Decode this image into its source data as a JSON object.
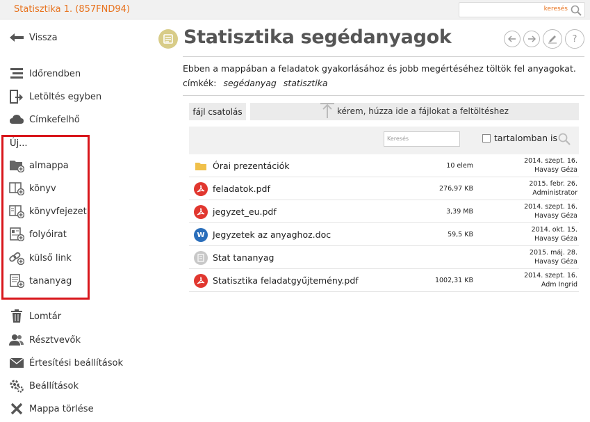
{
  "topbar": {
    "course_title": "Statisztika 1. (857FND94)",
    "search_placeholder": "keresés"
  },
  "sidebar": {
    "back": "Vissza",
    "items_top": [
      {
        "label": "Időrendben",
        "icon": "timeline-icon"
      },
      {
        "label": "Letöltés egyben",
        "icon": "download-icon"
      },
      {
        "label": "Címkefelhő",
        "icon": "tag-cloud-icon"
      }
    ],
    "new_label": "Új...",
    "new_items": [
      {
        "label": "almappa",
        "icon": "new-folder-icon"
      },
      {
        "label": "könyv",
        "icon": "new-book-icon"
      },
      {
        "label": "könyvfejezet",
        "icon": "new-chapter-icon"
      },
      {
        "label": "folyóirat",
        "icon": "new-journal-icon"
      },
      {
        "label": "külső link",
        "icon": "new-link-icon"
      },
      {
        "label": "tananyag",
        "icon": "new-material-icon"
      }
    ],
    "items_bottom": [
      {
        "label": "Lomtár",
        "icon": "trash-icon"
      },
      {
        "label": "Résztvevők",
        "icon": "participants-icon"
      },
      {
        "label": "Értesítési beállítások",
        "icon": "envelope-icon"
      },
      {
        "label": "Beállítások",
        "icon": "gear-icon"
      },
      {
        "label": "Mappa törlése",
        "icon": "delete-x-icon"
      }
    ]
  },
  "main": {
    "title": "Statisztika segédanyagok",
    "description": "Ebben a mappában a feladatok gyakorlásához és jobb megértéséhez töltök fel anyagokat.",
    "tags_label": "címkék:",
    "tags": [
      "segédanyag",
      "statisztika"
    ],
    "attach_label": "fájl csatolás",
    "dropzone_text": "kérem, húzza ide a fájlokat a feltöltéshez",
    "files_search_placeholder": "Keresés",
    "content_search_label": "tartalomban is",
    "files": [
      {
        "name": "Órai prezentációk",
        "type": "folder",
        "size": "10 elem",
        "date": "2014. szept. 16.",
        "user": "Havasy Géza"
      },
      {
        "name": "feladatok.pdf",
        "type": "pdf-gear",
        "size": "276,97 KB",
        "date": "2015. febr. 26.",
        "user": "Administrator"
      },
      {
        "name": "jegyzet_eu.pdf",
        "type": "pdf",
        "size": "3,39 MB",
        "date": "2014. szept. 16.",
        "user": "Havasy Géza"
      },
      {
        "name": "Jegyzetek az anyaghoz.doc",
        "type": "word",
        "size": "59,5 KB",
        "date": "2014. okt. 15.",
        "user": "Havasy Géza"
      },
      {
        "name": "Stat tananyag",
        "type": "material",
        "size": "",
        "date": "2015. máj. 28.",
        "user": "Havasy Géza"
      },
      {
        "name": "Statisztika feladatgyűjtemény.pdf",
        "type": "pdf",
        "size": "1002,31 KB",
        "date": "2014. szept. 16.",
        "user": "Adm Ingrid"
      }
    ]
  }
}
